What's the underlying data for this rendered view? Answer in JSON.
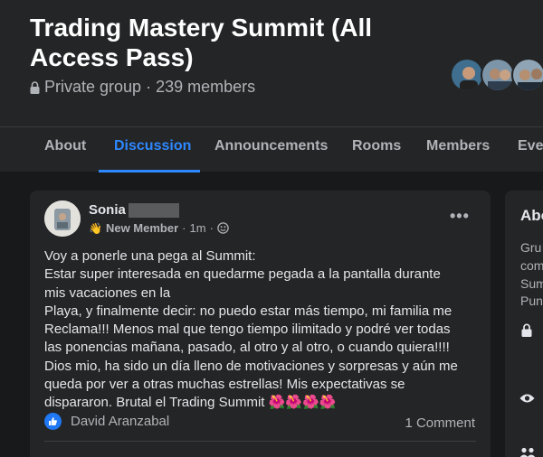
{
  "group": {
    "title": "Trading Mastery Summit (All Access Pass)",
    "privacy": "Private group",
    "separator": "·",
    "members": "239 members"
  },
  "tabs": [
    {
      "label": "About"
    },
    {
      "label": "Discussion"
    },
    {
      "label": "Announcements"
    },
    {
      "label": "Rooms"
    },
    {
      "label": "Members"
    },
    {
      "label": "Events"
    }
  ],
  "post": {
    "author": "Sonia",
    "badge": "New Member",
    "time": "1m",
    "separator": "·",
    "lines": [
      "Voy a ponerle una pega al Summit:",
      "Estar super interesada en quedarme pegada a la pantalla durante",
      "mis vacaciones en la",
      "Playa, y finalmente decir: no puedo estar más tiempo, mi familia me",
      "Reclama!!! Menos mal que tengo tiempo ilimitado y podré ver todas",
      "las ponencias mañana, pasado, al otro y al otro, o cuando quiera!!!!",
      "Dios mio, ha sido un día lleno de motivaciones y sorpresas y aún me",
      "queda por ver a otras muchas estrellas! Mis expectativas se",
      "dispararon. Brutal el Trading Summit"
    ],
    "flowers": "🌺🌺🌺🌺",
    "reactor": "David Aranzabal",
    "comments": "1 Comment",
    "more_label": "•••"
  },
  "side": {
    "title": "About",
    "lines": [
      "Gru",
      "com",
      "Sum",
      "Pun"
    ]
  },
  "colors": {
    "accent": "#2d88ff",
    "card": "#242526",
    "background": "#18191a"
  }
}
